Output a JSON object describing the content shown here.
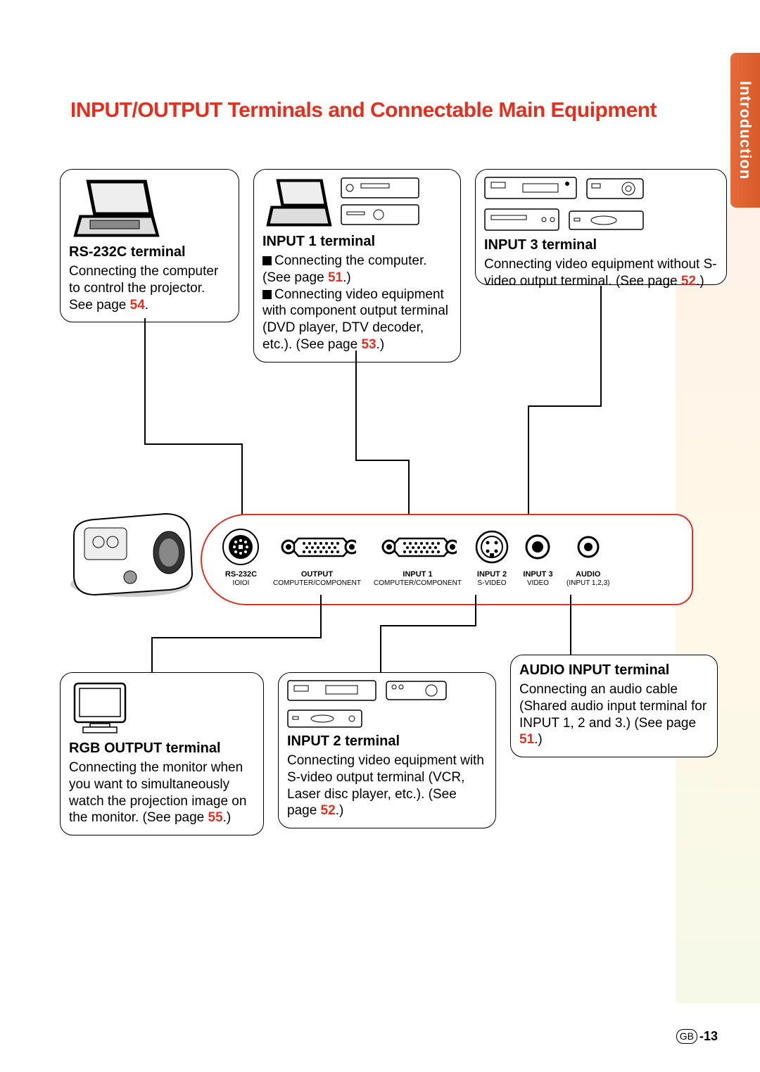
{
  "sideTab": "Introduction",
  "pageTitle": "INPUT/OUTPUT Terminals and Connectable Main Equipment",
  "footer": {
    "region": "GB",
    "page": "-13"
  },
  "boxes": {
    "rs232": {
      "title": "RS-232C terminal",
      "body_pre": "Connecting the computer to control the projector. See page ",
      "page": "54",
      "body_post": "."
    },
    "in1": {
      "title": "INPUT 1 terminal",
      "line1_pre": "Connecting the computer. (See page ",
      "line1_page": "51",
      "line1_post": ".)",
      "line2_pre": "Connecting video equipment with component output terminal (DVD player, DTV decoder, etc.). (See page ",
      "line2_page": "53",
      "line2_post": ".)"
    },
    "in3": {
      "title": "INPUT 3 terminal",
      "body_pre": "Connecting video equipment without S-video output terminal. (See page ",
      "page": "52",
      "body_post": ".)"
    },
    "rgb": {
      "title": "RGB OUTPUT terminal",
      "body_pre": "Connecting the monitor when you want to simultaneously watch the projection image on the monitor. (See page ",
      "page": "55",
      "body_post": ".)"
    },
    "in2": {
      "title": "INPUT 2 terminal",
      "body_pre": "Connecting video equipment with S-video output terminal (VCR, Laser disc player, etc.). (See page ",
      "page": "52",
      "body_post": ".)"
    },
    "audio": {
      "title": "AUDIO INPUT terminal",
      "body_pre": "Connecting an audio cable (Shared audio input terminal for INPUT 1, 2 and 3.) (See page ",
      "page": "51",
      "body_post": ".)"
    }
  },
  "ports": {
    "rs232": {
      "l1": "RS-232C",
      "l2": "IOIOI"
    },
    "output": {
      "l1": "OUTPUT",
      "l2": "COMPUTER/COMPONENT"
    },
    "in1": {
      "l1": "INPUT 1",
      "l2": "COMPUTER/COMPONENT"
    },
    "in2": {
      "l1": "INPUT 2",
      "l2": "S-VIDEO"
    },
    "in3": {
      "l1": "INPUT 3",
      "l2": "VIDEO"
    },
    "audio": {
      "l1": "AUDIO",
      "l2": "(INPUT 1,2,3)"
    }
  }
}
